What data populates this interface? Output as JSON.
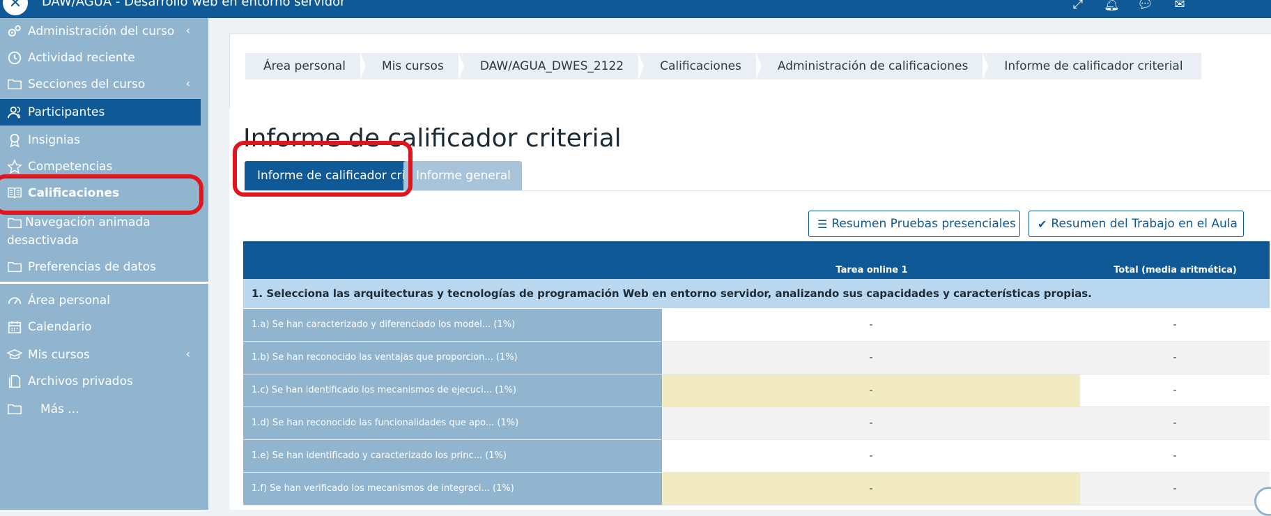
{
  "header": {
    "title": "DAW/AGUA - Desarrollo web en entorno servidor",
    "icons": [
      "expand-icon",
      "bell-icon",
      "chat-icon",
      "mail-icon"
    ]
  },
  "sidebar": {
    "items": [
      {
        "label": "Administración del curso",
        "icon": "gears-icon",
        "chevron": "‹"
      },
      {
        "label": "Actividad reciente",
        "icon": "clock-icon"
      },
      {
        "label": "Secciones del curso",
        "icon": "folder-icon",
        "chevron": "‹"
      },
      {
        "label": "Participantes",
        "icon": "users-icon"
      },
      {
        "label": "Insignias",
        "icon": "badge-icon"
      },
      {
        "label": "Competencias",
        "icon": "star-icon"
      },
      {
        "label": "Calificaciones",
        "icon": "book-icon"
      },
      {
        "label": "Navegación animada desactivada",
        "icon": "folder-icon"
      },
      {
        "label": "Preferencias de datos",
        "icon": "folder-icon"
      },
      {
        "label": "Área personal",
        "icon": "dashboard-icon"
      },
      {
        "label": "Calendario",
        "icon": "calendar-icon"
      },
      {
        "label": "Mis cursos",
        "icon": "graduation-icon",
        "chevron": "‹"
      },
      {
        "label": "Archivos privados",
        "icon": "files-icon"
      },
      {
        "label": "Más ...",
        "icon": "folder-icon"
      }
    ]
  },
  "breadcrumb": [
    "Área personal",
    "Mis cursos",
    "DAW/AGUA_DWES_2122",
    "Calificaciones",
    "Administración de calificaciones",
    "Informe de calificador criterial"
  ],
  "page_title": "Informe de calificador criterial",
  "tabs": [
    {
      "label": "Informe de calificador criterial"
    },
    {
      "label": "Informe general"
    }
  ],
  "buttons": {
    "resumen_pruebas": "Resumen Pruebas presenciales",
    "resumen_trabajo": "Resumen del Trabajo en el Aula"
  },
  "table": {
    "headers": [
      "Tarea online 1",
      "Total (media aritmética)"
    ],
    "section": "1. Selecciona las arquitecturas y tecnologías de programación Web en entorno servidor, analizando sus capacidades y características propias.",
    "rows": [
      {
        "criterion": "1.a) Se han caracterizado y diferenciado los model... (1%)",
        "tarea": "-",
        "total": "-"
      },
      {
        "criterion": "1.b) Se han reconocido las ventajas que proporcion... (1%)",
        "tarea": "-",
        "total": "-"
      },
      {
        "criterion": "1.c) Se han identificado los mecanismos de ejecuci... (1%)",
        "tarea": "-",
        "total": "-"
      },
      {
        "criterion": "1.d) Se han reconocido las funcionalidades que apo... (1%)",
        "tarea": "-",
        "total": "-"
      },
      {
        "criterion": "1.e) Se han identificado y caracterizado los princ... (1%)",
        "tarea": "-",
        "total": "-"
      },
      {
        "criterion": "1.f) Se han verificado los mecanismos de integraci... (1%)",
        "tarea": "-",
        "total": "-"
      }
    ]
  },
  "colors": {
    "primary": "#0f5a96",
    "sidebar": "#91b5cf",
    "highlight": "#e0161e",
    "section_row": "#b9d7ef",
    "yellow_cell": "#f2ebc2"
  }
}
